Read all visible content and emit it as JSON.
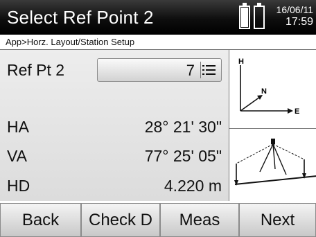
{
  "header": {
    "title": "Select Ref Point 2",
    "date": "16/06/11",
    "time": "17:59",
    "battery_icons": [
      "battery-icon",
      "battery-icon"
    ]
  },
  "breadcrumb": "App>Horz. Layout/Station Setup",
  "fields": {
    "ref_pt": {
      "label": "Ref Pt 2",
      "value": "7"
    },
    "ha": {
      "label": "HA",
      "value": "28° 21' 30\""
    },
    "va": {
      "label": "VA",
      "value": "77° 25' 05\""
    },
    "hd": {
      "label": "HD",
      "value": "4.220 m"
    }
  },
  "diagram": {
    "axis_h": "H",
    "axis_n": "N",
    "axis_e": "E"
  },
  "softkeys": {
    "back": "Back",
    "check_d": "Check D",
    "meas": "Meas",
    "next": "Next"
  },
  "icons": {
    "list": "list-icon",
    "coordinate_axes": "coordinate-axes-icon",
    "station_setup": "station-setup-diagram-icon"
  }
}
